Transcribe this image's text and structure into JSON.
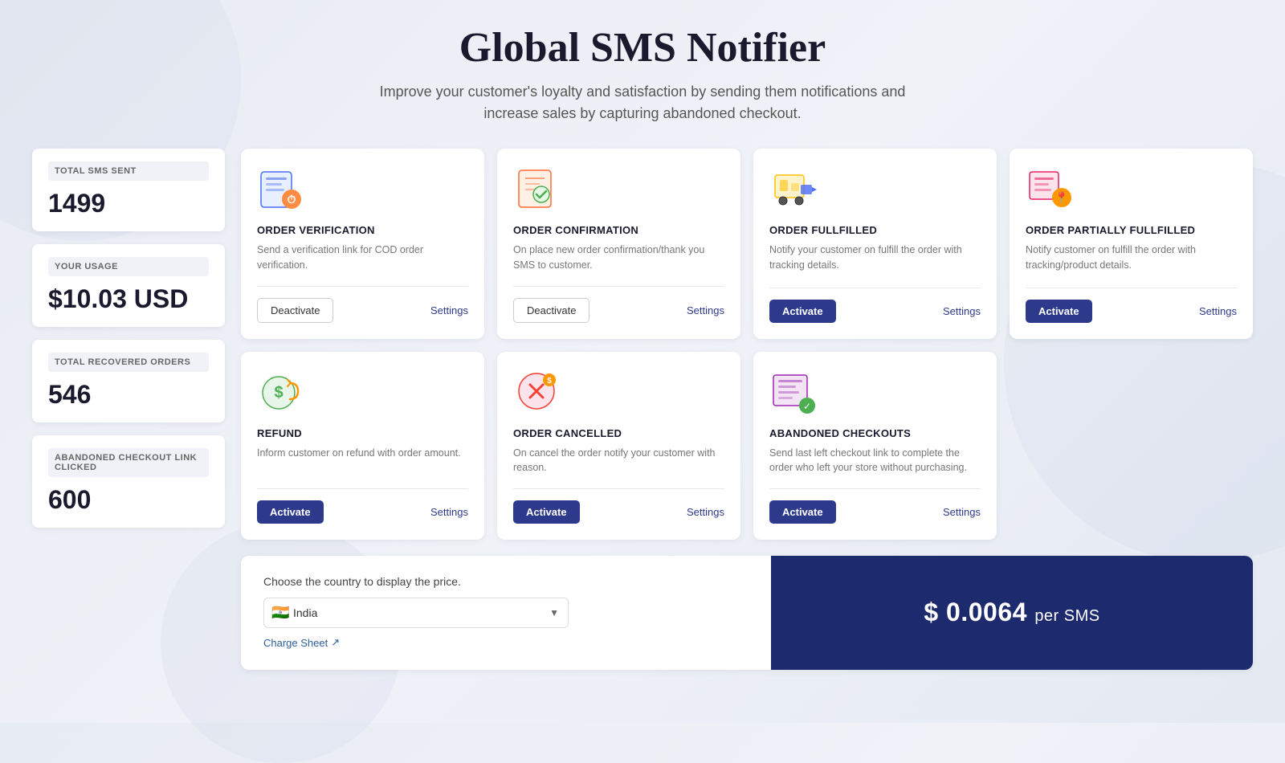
{
  "header": {
    "title": "Global SMS Notifier",
    "subtitle": "Improve your customer's loyalty and satisfaction by sending them notifications and\nincrease sales by capturing abandoned checkout."
  },
  "stats": [
    {
      "id": "total-sms-sent",
      "label": "TOTAL SMS SENT",
      "value": "1499"
    },
    {
      "id": "your-usage",
      "label": "YOUR USAGE",
      "value": "$10.03 USD"
    },
    {
      "id": "total-recovered-orders",
      "label": "TOTAL RECOVERED ORDERS",
      "value": "546"
    },
    {
      "id": "abandoned-checkout-link",
      "label": "ABANDONED CHECKOUT LINK CLICKED",
      "value": "600"
    }
  ],
  "cards": [
    {
      "id": "order-verification",
      "icon": "📋",
      "title": "ORDER VERIFICATION",
      "description": "Send a verification link for COD order verification.",
      "primaryButton": "Deactivate",
      "primaryButtonType": "deactivate",
      "secondaryButton": "Settings"
    },
    {
      "id": "order-confirmation",
      "icon": "📝",
      "title": "ORDER CONFIRMATION",
      "description": "On place new order confirmation/thank you SMS to customer.",
      "primaryButton": "Deactivate",
      "primaryButtonType": "deactivate",
      "secondaryButton": "Settings"
    },
    {
      "id": "order-fulfilled",
      "icon": "🚚",
      "title": "ORDER FULLFILLED",
      "description": "Notify your customer on fulfill the order with tracking details.",
      "primaryButton": "Activate",
      "primaryButtonType": "activate",
      "secondaryButton": "Settings"
    },
    {
      "id": "order-partial",
      "icon": "📦",
      "title": "ORDER PARTIALLY FULLFILLED",
      "description": "Notify customer on fulfill the order with tracking/product details.",
      "primaryButton": "Activate",
      "primaryButtonType": "activate",
      "secondaryButton": "Settings"
    },
    {
      "id": "refund",
      "icon": "💰",
      "title": "REFUND",
      "description": "Inform customer on refund with order amount.",
      "primaryButton": "Activate",
      "primaryButtonType": "activate",
      "secondaryButton": "Settings"
    },
    {
      "id": "order-cancelled",
      "icon": "❌",
      "title": "ORDER CANCELLED",
      "description": "On cancel the order notify your customer with reason.",
      "primaryButton": "Activate",
      "primaryButtonType": "activate",
      "secondaryButton": "Settings"
    },
    {
      "id": "abandoned-checkouts",
      "icon": "🛒",
      "title": "ABANDONED CHECKOUTS",
      "description": "Send last left checkout link to complete the order who left your store without purchasing.",
      "primaryButton": "Activate",
      "primaryButtonType": "activate",
      "secondaryButton": "Settings"
    }
  ],
  "bottom": {
    "countryLabel": "Choose the country to display the price.",
    "selectedCountry": "India",
    "selectedFlag": "🇮🇳",
    "chargeSheetText": "Charge Sheet",
    "priceText": "$ 0.0064",
    "priceUnit": "per SMS"
  }
}
